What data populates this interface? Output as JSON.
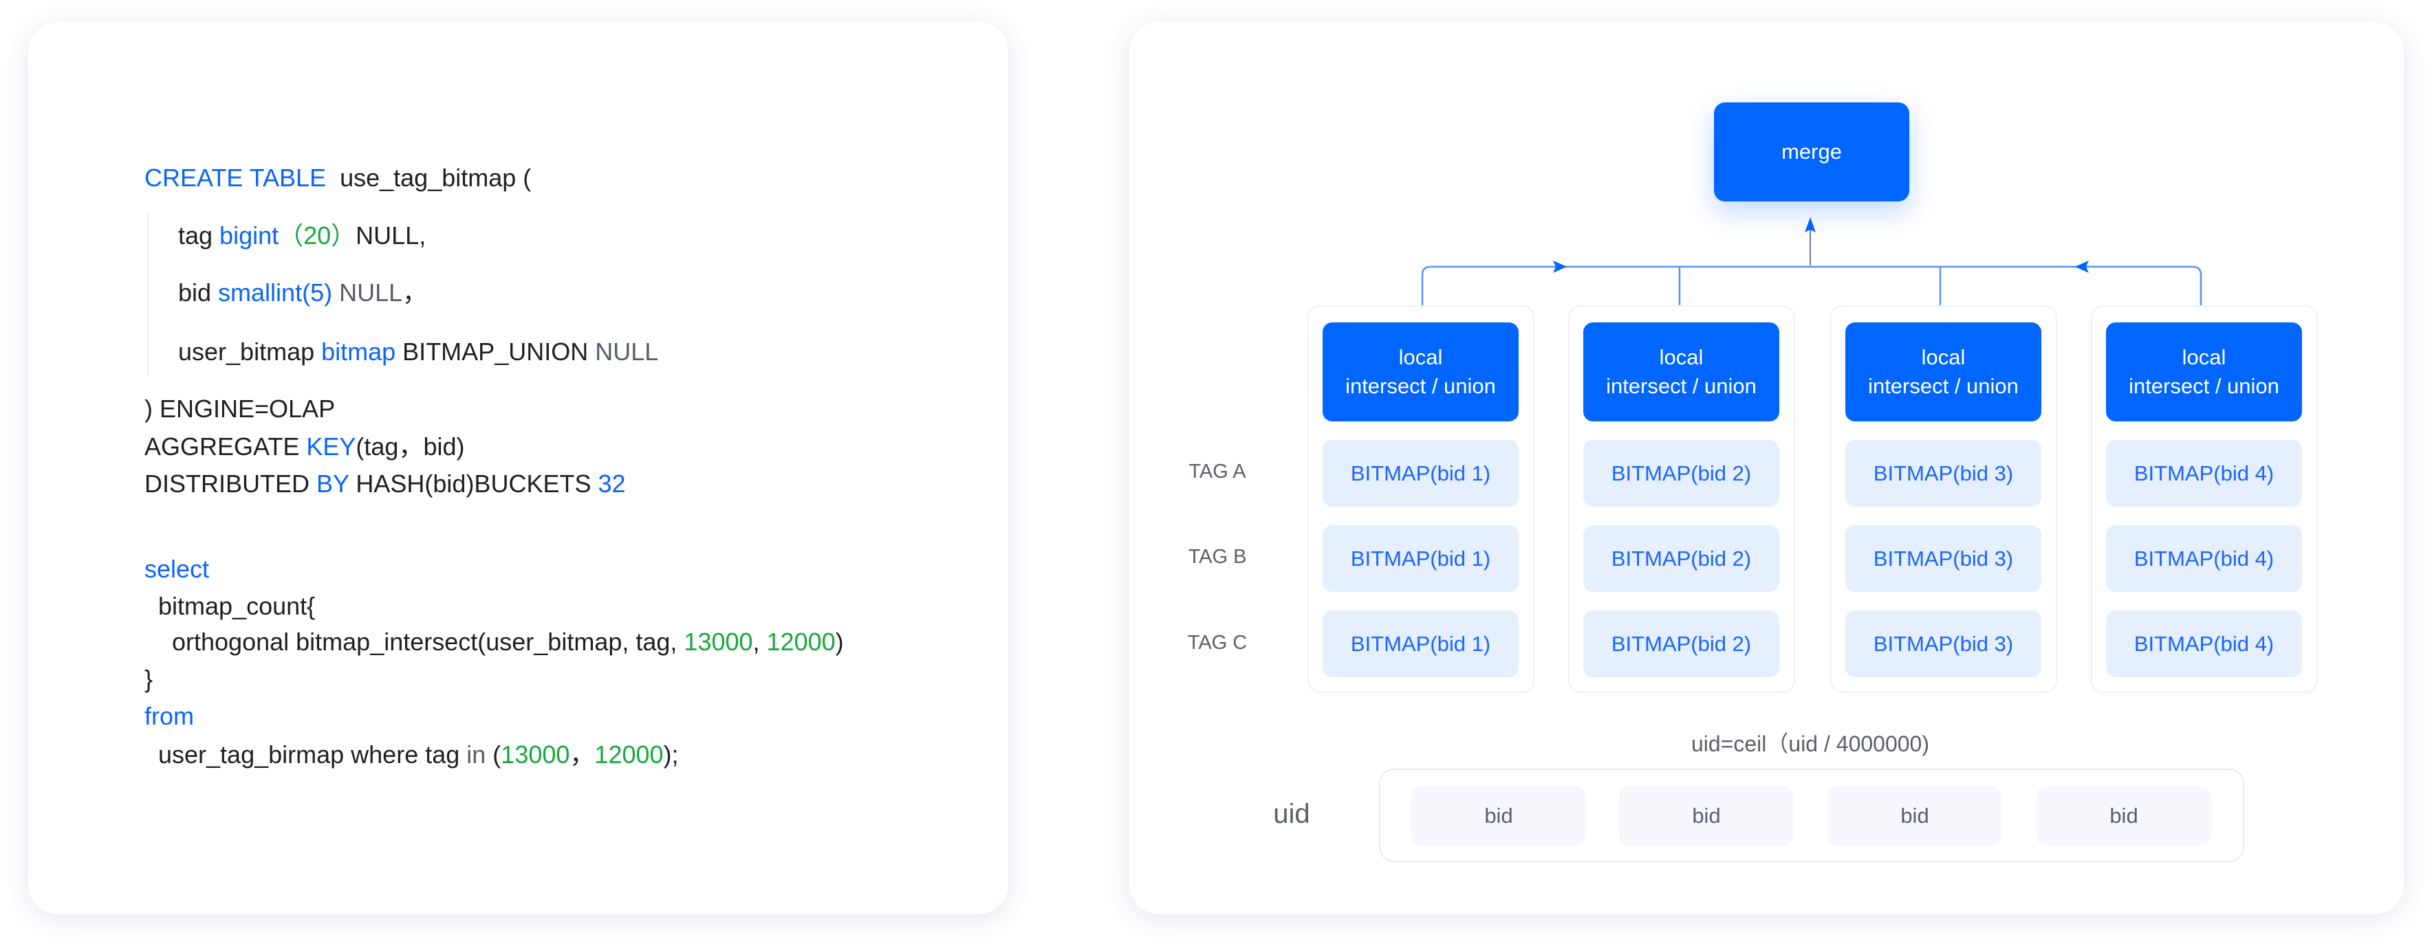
{
  "code": {
    "lines": [
      [
        {
          "t": "CREATE TABLE",
          "c": "kw"
        },
        {
          "t": "  use_tag_bitmap (",
          "c": "plain"
        }
      ],
      [
        {
          "t": "tag ",
          "c": "plain"
        },
        {
          "t": "bigint",
          "c": "kw"
        },
        {
          "t": "（20）",
          "c": "num"
        },
        {
          "t": "NULL,",
          "c": "plain"
        }
      ],
      [
        {
          "t": "bid ",
          "c": "plain"
        },
        {
          "t": "smallint(5)",
          "c": "kw"
        },
        {
          "t": " NULL",
          "c": "muted"
        },
        {
          "t": "，",
          "c": "plain"
        }
      ],
      [
        {
          "t": "user_bitmap ",
          "c": "plain"
        },
        {
          "t": "bitmap",
          "c": "kw"
        },
        {
          "t": " BITMAP_UNION ",
          "c": "plain"
        },
        {
          "t": "NULL",
          "c": "muted"
        }
      ],
      [
        {
          "t": ") ENGINE=OLAP",
          "c": "plain"
        }
      ],
      [
        {
          "t": "AGGREGATE ",
          "c": "plain"
        },
        {
          "t": "KEY",
          "c": "kw"
        },
        {
          "t": "(tag，bid)",
          "c": "plain"
        }
      ],
      [
        {
          "t": "DISTRIBUTED ",
          "c": "plain"
        },
        {
          "t": "BY",
          "c": "kw"
        },
        {
          "t": " HASH(bid)BUCKETS ",
          "c": "plain"
        },
        {
          "t": "32",
          "c": "kw"
        }
      ],
      [
        {
          "t": "select",
          "c": "kw"
        }
      ],
      [
        {
          "t": "bitmap_count{",
          "c": "plain"
        }
      ],
      [
        {
          "t": "orthogonal bitmap_intersect(user_bitmap, tag, ",
          "c": "plain"
        },
        {
          "t": "13000",
          "c": "num"
        },
        {
          "t": ", ",
          "c": "plain"
        },
        {
          "t": "12000",
          "c": "num"
        },
        {
          "t": ")",
          "c": "plain"
        }
      ],
      [
        {
          "t": "}",
          "c": "plain"
        }
      ],
      [
        {
          "t": "from",
          "c": "kw"
        }
      ],
      [
        {
          "t": "user_tag_birmap where tag ",
          "c": "plain"
        },
        {
          "t": "in",
          "c": "muted"
        },
        {
          "t": " (",
          "c": "plain"
        },
        {
          "t": "13000",
          "c": "num"
        },
        {
          "t": "，",
          "c": "plain"
        },
        {
          "t": "12000",
          "c": "num"
        },
        {
          "t": ");",
          "c": "plain"
        }
      ]
    ]
  },
  "diagram": {
    "merge_label": "merge",
    "local_label_line1": "local",
    "local_label_line2": "intersect / union",
    "tags": [
      "TAG A",
      "TAG B",
      "TAG C"
    ],
    "columns": [
      {
        "bitmap": "BITMAP(bid 1)"
      },
      {
        "bitmap": "BITMAP(bid 2)"
      },
      {
        "bitmap": "BITMAP(bid 3)"
      },
      {
        "bitmap": "BITMAP(bid 4)"
      }
    ],
    "formula": "uid=ceil（uid / 4000000)",
    "uid_label": "uid",
    "bids": [
      "bid",
      "bid",
      "bid",
      "bid"
    ]
  },
  "colors": {
    "accent": "#0066ff",
    "bitmap_bg": "#e5effd",
    "number": "#1aa83a",
    "keyword": "#0a64ff"
  }
}
